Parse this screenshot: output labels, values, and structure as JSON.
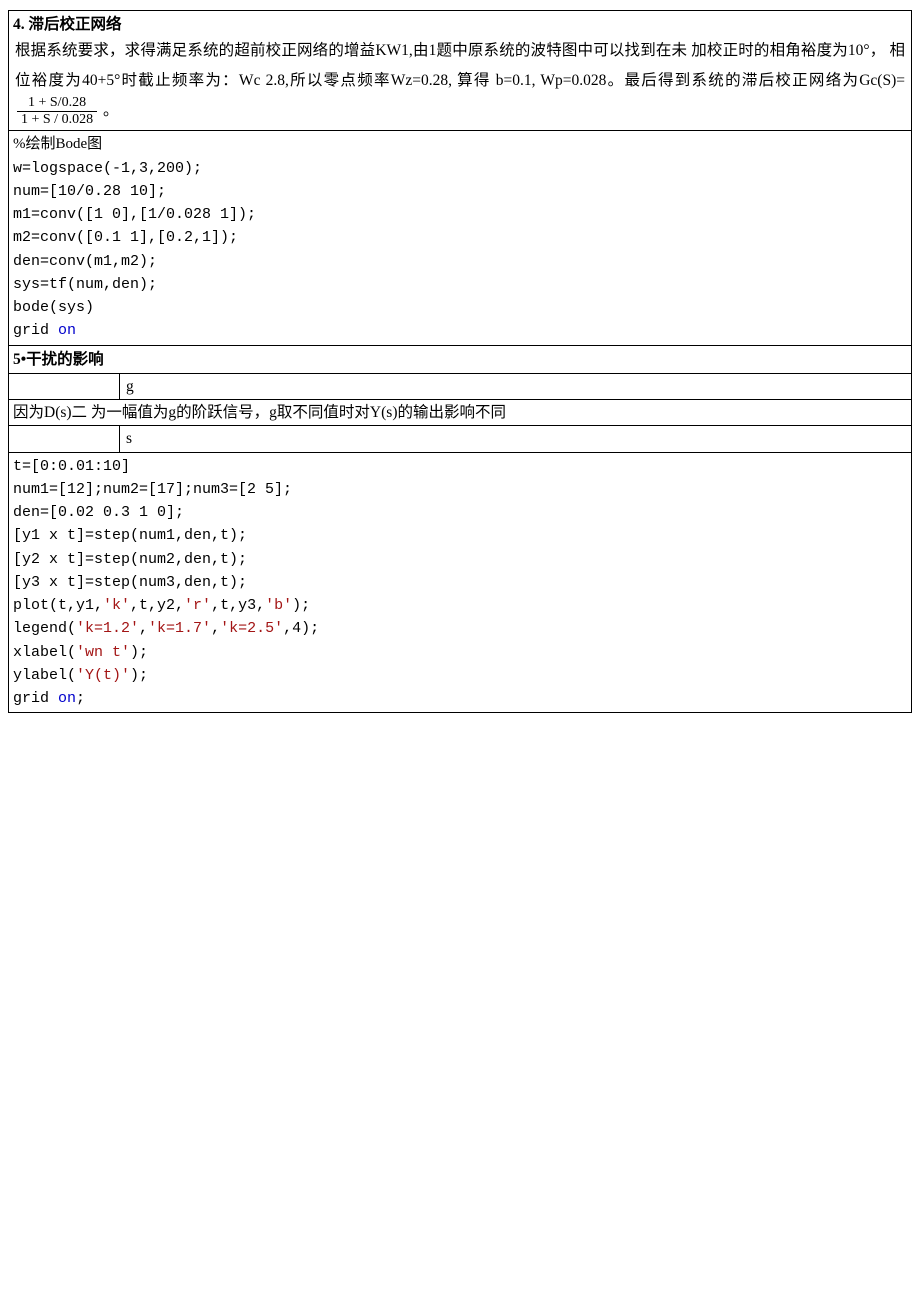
{
  "section4": {
    "heading": "4.  滞后校正网络",
    "para": "根据系统要求，求得满足系统的超前校正网络的增益KW1,由1题中原系统的波特图中可以找到在未 加校正时的相角裕度为10°， 相位裕度为40+5°时截止频率为：Wc 2.8,所以零点频率Wz=0.28, 算得 b=0.1, Wp=0.028。最后得到系统的滞后校正网络为Gc(S)=",
    "frac_num": "1 + S/0.28",
    "frac_den": "1 + S / 0.028",
    "para_end": "。"
  },
  "code1": {
    "title": "%绘制Bode图",
    "l1": "w=logspace(-1,3,200);",
    "l2": "num=[10/0.28 10];",
    "l3": "m1=conv([1 0],[1/0.028 1]);",
    "l4": "m2=conv([0.1 1],[0.2,1]);",
    "l5": "den=conv(m1,m2);",
    "l6": "sys=tf(num,den);",
    "l7": "bode(sys)",
    "l8a": "grid ",
    "l8b": "on"
  },
  "section5": {
    "heading": "5•干扰的影响",
    "g": "g",
    "mid": "因为D(s)二 为一幅值为g的阶跃信号，g取不同值时对Y(s)的输出影响不同",
    "s": "s"
  },
  "code2": {
    "l1": "t=[0:0.01:10]",
    "l2": "num1=[12];num2=[17];num3=[2 5];",
    "l3": "den=[0.02 0.3 1 0];",
    "l4": "[y1 x t]=step(num1,den,t);",
    "l5": "[y2 x t]=step(num2,den,t);",
    "l6": "[y3 x t]=step(num3,den,t);",
    "l7a": "plot(t,y1,",
    "l7b": "'k'",
    "l7c": ",t,y2,",
    "l7d": "'r'",
    "l7e": ",t,y3,",
    "l7f": "'b'",
    "l7g": ");",
    "l8a": "legend(",
    "l8b": "'k=1.2'",
    "l8c": ",",
    "l8d": "'k=1.7'",
    "l8e": ",",
    "l8f": "'k=2.5'",
    "l8g": ",4);",
    "l9a": "xlabel(",
    "l9b": "'wn t'",
    "l9c": ");",
    "l10a": "ylabel(",
    "l10b": "'Y(t)'",
    "l10c": ");",
    "l11a": "grid ",
    "l11b": "on",
    "l11c": ";"
  }
}
